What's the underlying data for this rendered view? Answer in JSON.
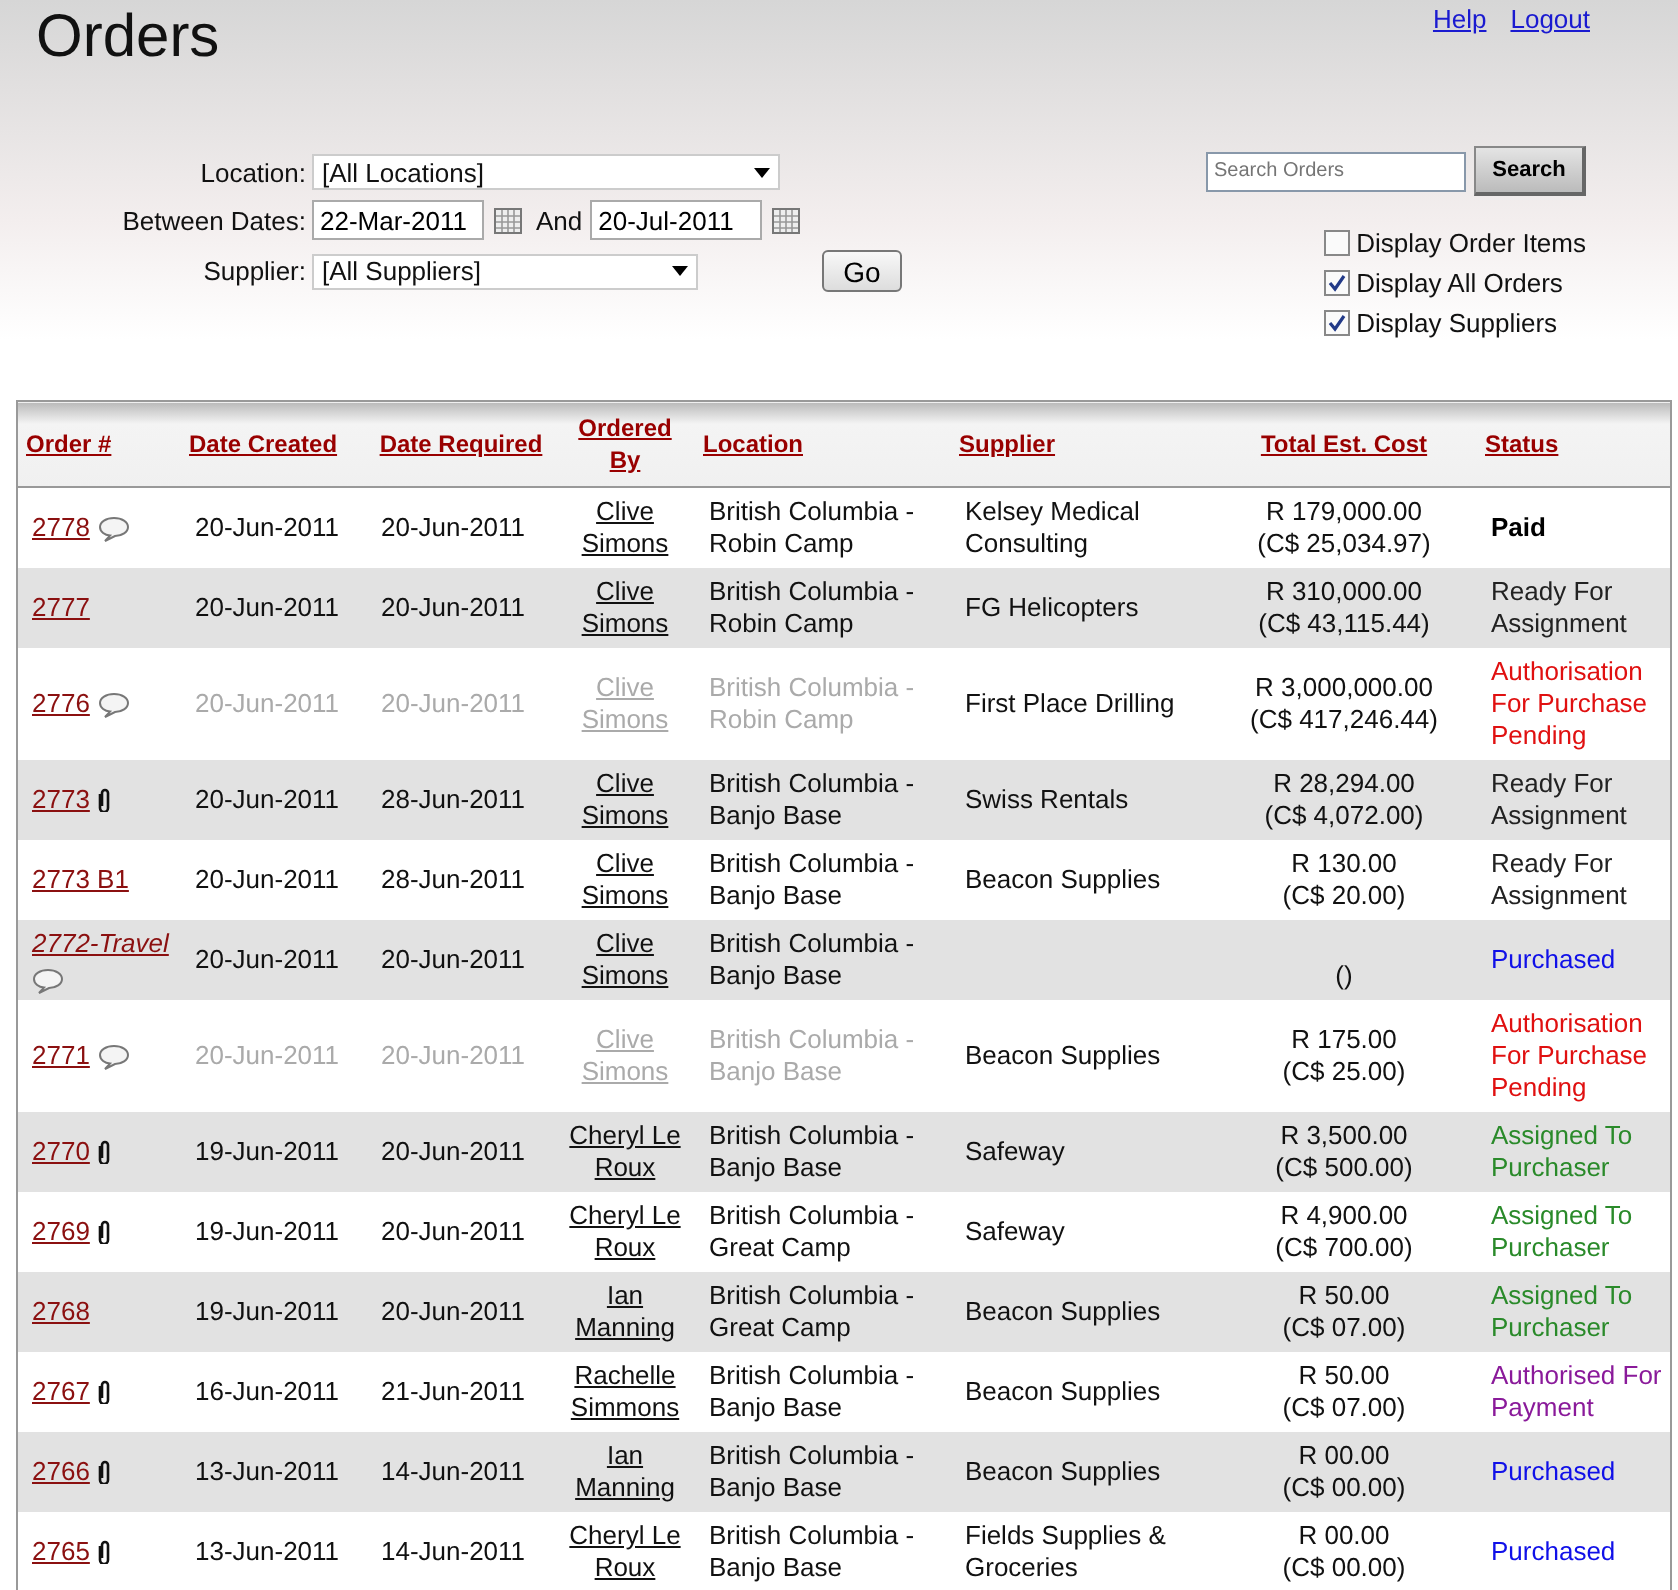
{
  "title": "Orders",
  "links": [
    "Help",
    "Logout"
  ],
  "filters": {
    "location_label": "Location:",
    "location_value": "[All Locations]",
    "dates_label": "Between Dates:",
    "date_from": "22-Mar-2011",
    "and_label": "And",
    "date_to": "20-Jul-2011",
    "supplier_label": "Supplier:",
    "supplier_value": "[All Suppliers]",
    "go": "Go"
  },
  "search": {
    "placeholder": "Search Orders",
    "button": "Search"
  },
  "options": [
    {
      "label": "Display Order Items",
      "checked": false
    },
    {
      "label": "Display All Orders",
      "checked": true
    },
    {
      "label": "Display Suppliers",
      "checked": true
    }
  ],
  "table": {
    "columns": [
      "Order #",
      "Date Created",
      "Date Required",
      "Ordered By",
      "Location",
      "Supplier",
      "Total Est. Cost",
      "Status"
    ],
    "rows": [
      {
        "order": "2778",
        "kind": "comment",
        "italic": false,
        "muted": false,
        "created": "20-Jun-2011",
        "required": "20-Jun-2011",
        "by": "Clive Simons",
        "location": "British Columbia - Robin Camp",
        "supplier": "Kelsey Medical Consulting",
        "cost": "R 179,000.00",
        "cost_cad": "(C$ 25,034.97)",
        "status": {
          "text": "Paid",
          "kind": "paid"
        }
      },
      {
        "order": "2777",
        "kind": "plain",
        "italic": false,
        "muted": false,
        "created": "20-Jun-2011",
        "required": "20-Jun-2011",
        "by": "Clive Simons",
        "location": "British Columbia - Robin Camp",
        "supplier": "FG Helicopters",
        "cost": "R 310,000.00",
        "cost_cad": "(C$ 43,115.44)",
        "status": {
          "text": "Ready For Assignment",
          "kind": "ready"
        }
      },
      {
        "order": "2776",
        "kind": "comment",
        "italic": false,
        "muted": true,
        "created": "20-Jun-2011",
        "required": "20-Jun-2011",
        "by": "Clive Simons",
        "location": "British Columbia - Robin Camp",
        "supplier": "First Place Drilling",
        "cost": "R 3,000,000.00",
        "cost_cad": "(C$ 417,246.44)",
        "status": {
          "text": "Authorisation For Purchase Pending",
          "kind": "pending"
        }
      },
      {
        "order": "2773",
        "kind": "attachment",
        "italic": false,
        "muted": false,
        "created": "20-Jun-2011",
        "required": "28-Jun-2011",
        "by": "Clive Simons",
        "location": "British Columbia - Banjo Base",
        "supplier": "Swiss Rentals",
        "cost": "R 28,294.00",
        "cost_cad": "(C$ 4,072.00)",
        "status": {
          "text": "Ready For Assignment",
          "kind": "ready"
        }
      },
      {
        "order": "2773 B1",
        "kind": "plain",
        "italic": false,
        "muted": false,
        "created": "20-Jun-2011",
        "required": "28-Jun-2011",
        "by": "Clive Simons",
        "location": "British Columbia - Banjo Base",
        "supplier": "Beacon Supplies",
        "cost": "R 130.00",
        "cost_cad": "(C$ 20.00)",
        "status": {
          "text": "Ready For Assignment",
          "kind": "ready"
        }
      },
      {
        "order": "2772-Travel",
        "kind": "comment",
        "italic": true,
        "muted": false,
        "created": "20-Jun-2011",
        "required": "20-Jun-2011",
        "by": "Clive Simons",
        "location": "British Columbia - Banjo Base",
        "cost_cad": "()",
        "status": {
          "text": "Purchased",
          "kind": "purchased"
        }
      },
      {
        "order": "2771",
        "kind": "comment",
        "italic": false,
        "muted": true,
        "created": "20-Jun-2011",
        "required": "20-Jun-2011",
        "by": "Clive Simons",
        "location": "British Columbia - Banjo Base",
        "supplier": "Beacon Supplies",
        "cost": "R 175.00",
        "cost_cad": "(C$ 25.00)",
        "status": {
          "text": "Authorisation For Purchase Pending",
          "kind": "pending"
        }
      },
      {
        "order": "2770",
        "kind": "attachment",
        "italic": false,
        "muted": false,
        "created": "19-Jun-2011",
        "required": "20-Jun-2011",
        "by": "Cheryl Le Roux",
        "location": "British Columbia - Banjo Base",
        "supplier": "Safeway",
        "cost": "R 3,500.00",
        "cost_cad": "(C$ 500.00)",
        "status": {
          "text": "Assigned To Purchaser",
          "kind": "assigned"
        }
      },
      {
        "order": "2769",
        "kind": "attachment",
        "italic": false,
        "muted": false,
        "created": "19-Jun-2011",
        "required": "20-Jun-2011",
        "by": "Cheryl Le Roux",
        "location": "British Columbia - Great Camp",
        "supplier": "Safeway",
        "cost": "R 4,900.00",
        "cost_cad": "(C$ 700.00)",
        "status": {
          "text": "Assigned To Purchaser",
          "kind": "assigned"
        }
      },
      {
        "order": "2768",
        "kind": "plain",
        "italic": false,
        "muted": false,
        "created": "19-Jun-2011",
        "required": "20-Jun-2011",
        "by": "Ian Manning",
        "location": "British Columbia - Great Camp",
        "supplier": "Beacon Supplies",
        "cost": "R 50.00",
        "cost_cad": "(C$ 07.00)",
        "status": {
          "text": "Assigned To Purchaser",
          "kind": "assigned"
        }
      },
      {
        "order": "2767",
        "kind": "attachment",
        "italic": false,
        "muted": false,
        "created": "16-Jun-2011",
        "required": "21-Jun-2011",
        "by": "Rachelle Simmons",
        "location": "British Columbia - Banjo Base",
        "supplier": "Beacon Supplies",
        "cost": "R 50.00",
        "cost_cad": "(C$ 07.00)",
        "status": {
          "text": "Authorised For Payment",
          "kind": "authorised"
        }
      },
      {
        "order": "2766",
        "kind": "attachment",
        "italic": false,
        "muted": false,
        "created": "13-Jun-2011",
        "required": "14-Jun-2011",
        "by": "Ian Manning",
        "location": "British Columbia - Banjo Base",
        "supplier": "Beacon Supplies",
        "cost": "R 00.00",
        "cost_cad": "(C$ 00.00)",
        "status": {
          "text": "Purchased",
          "kind": "purchased"
        }
      },
      {
        "order": "2765",
        "kind": "attachment",
        "italic": false,
        "muted": false,
        "created": "13-Jun-2011",
        "required": "14-Jun-2011",
        "by": "Cheryl Le Roux",
        "location": "British Columbia - Banjo Base",
        "supplier": "Fields Supplies & Groceries",
        "cost": "R 00.00",
        "cost_cad": "(C$ 00.00)",
        "status": {
          "text": "Purchased",
          "kind": "purchased"
        }
      }
    ]
  }
}
